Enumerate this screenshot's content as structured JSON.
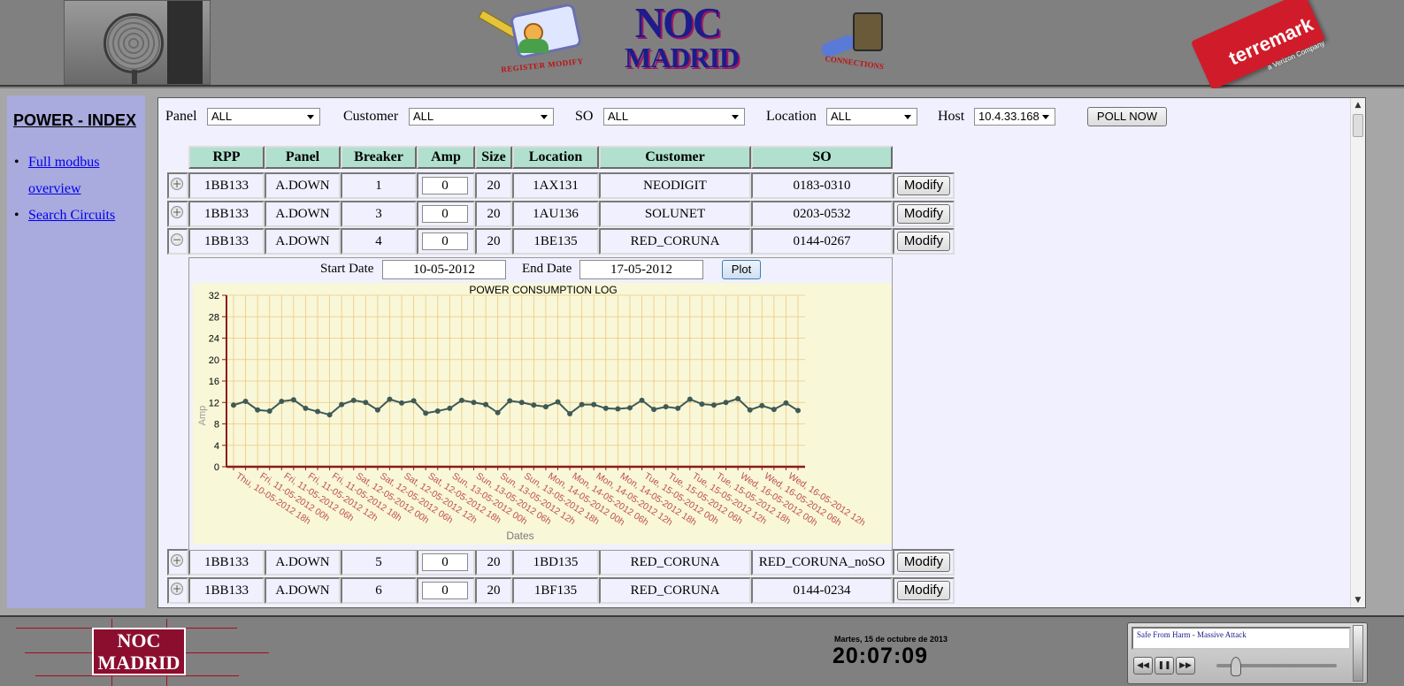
{
  "header": {
    "register_logo_text": "REGISTER MODIFY",
    "noc_logo_line1": "NOC",
    "noc_logo_line2": "MADRID",
    "connections_logo_text": "CONNECTIONS",
    "terremark_logo_text": "terremark",
    "terremark_sub": "a Verizon Company"
  },
  "sidebar": {
    "title": "POWER - INDEX",
    "links": [
      {
        "label": "Full modbus overview"
      },
      {
        "label": "Search Circuits"
      }
    ]
  },
  "filters": {
    "panel_label": "Panel",
    "panel_value": "ALL",
    "customer_label": "Customer",
    "customer_value": "ALL",
    "so_label": "SO",
    "so_value": "ALL",
    "location_label": "Location",
    "location_value": "ALL",
    "host_label": "Host",
    "host_value": "10.4.33.168",
    "poll_button": "POLL NOW"
  },
  "table": {
    "columns": [
      "RPP",
      "Panel",
      "Breaker",
      "Amp",
      "Size",
      "Location",
      "Customer",
      "SO"
    ],
    "modify_label": "Modify",
    "rows": [
      {
        "rpp": "1BB133",
        "panel": "A.DOWN",
        "breaker": "1",
        "amp": "0",
        "size": "20",
        "location": "1AX131",
        "customer": "NEODIGIT",
        "so": "0183-0310",
        "expander": "+"
      },
      {
        "rpp": "1BB133",
        "panel": "A.DOWN",
        "breaker": "3",
        "amp": "0",
        "size": "20",
        "location": "1AU136",
        "customer": "SOLUNET",
        "so": "0203-0532",
        "expander": "+"
      },
      {
        "rpp": "1BB133",
        "panel": "A.DOWN",
        "breaker": "4",
        "amp": "0",
        "size": "20",
        "location": "1BE135",
        "customer": "RED_CORUNA",
        "so": "0144-0267",
        "expander": "−"
      },
      {
        "rpp": "1BB133",
        "panel": "A.DOWN",
        "breaker": "5",
        "amp": "0",
        "size": "20",
        "location": "1BD135",
        "customer": "RED_CORUNA",
        "so": "RED_CORUNA_noSO",
        "expander": "+"
      },
      {
        "rpp": "1BB133",
        "panel": "A.DOWN",
        "breaker": "6",
        "amp": "0",
        "size": "20",
        "location": "1BF135",
        "customer": "RED_CORUNA",
        "so": "0144-0234",
        "expander": "+"
      }
    ]
  },
  "detail": {
    "start_label": "Start Date",
    "start_value": "10-05-2012",
    "end_label": "End Date",
    "end_value": "17-05-2012",
    "plot_button": "Plot"
  },
  "chart_data": {
    "type": "line",
    "title": "POWER CONSUMPTION LOG",
    "xlabel": "Dates",
    "ylabel": "Amp",
    "ylim": [
      0,
      32
    ],
    "yticks": [
      0,
      4,
      8,
      12,
      16,
      20,
      24,
      28,
      32
    ],
    "grid": true,
    "background": "#f8f7d8",
    "grid_color": "#f0c87a",
    "axis_color": "#8b1a1a",
    "line_color": "#3e5a56",
    "tick_label_color": "#c0504d",
    "x_tick_labels": [
      "Thu, 10-05-2012 18h",
      "Fri, 11-05-2012 00h",
      "Fri, 11-05-2012 06h",
      "Fri, 11-05-2012 12h",
      "Fri, 11-05-2012 18h",
      "Sat, 12-05-2012 00h",
      "Sat, 12-05-2012 06h",
      "Sat, 12-05-2012 12h",
      "Sat, 12-05-2012 18h",
      "Sun, 13-05-2012 00h",
      "Sun, 13-05-2012 06h",
      "Sun, 13-05-2012 12h",
      "Sun, 13-05-2012 18h",
      "Mon, 14-05-2012 00h",
      "Mon, 14-05-2012 06h",
      "Mon, 14-05-2012 12h",
      "Mon, 14-05-2012 18h",
      "Tue, 15-05-2012 00h",
      "Tue, 15-05-2012 06h",
      "Tue, 15-05-2012 12h",
      "Tue, 15-05-2012 18h",
      "Wed, 16-05-2012 00h",
      "Wed, 16-05-2012 06h",
      "Wed, 16-05-2012 12h"
    ],
    "series": [
      {
        "values": [
          11.5,
          12.2,
          10.6,
          10.4,
          12.2,
          12.5,
          10.9,
          10.3,
          9.7,
          11.6,
          12.4,
          12.0,
          10.6,
          12.6,
          11.9,
          12.3,
          10.0,
          10.4,
          10.9,
          12.4,
          12.0,
          11.6,
          10.1,
          12.3,
          12.0,
          11.5,
          11.2,
          12.1,
          9.9,
          11.6,
          11.6,
          10.9,
          10.8,
          11.0,
          12.4,
          10.7,
          11.2,
          10.9,
          12.6,
          11.7,
          11.5,
          12.0,
          12.7,
          10.6,
          11.4,
          10.7,
          11.9,
          10.5
        ]
      }
    ]
  },
  "footer": {
    "noc_line1": "NOC",
    "noc_line2": "MADRID",
    "date_text": "Martes, 15 de octubre de 2013",
    "time_text": "20:07:09",
    "track_title": "Safe From Harm - Massive Attack"
  }
}
